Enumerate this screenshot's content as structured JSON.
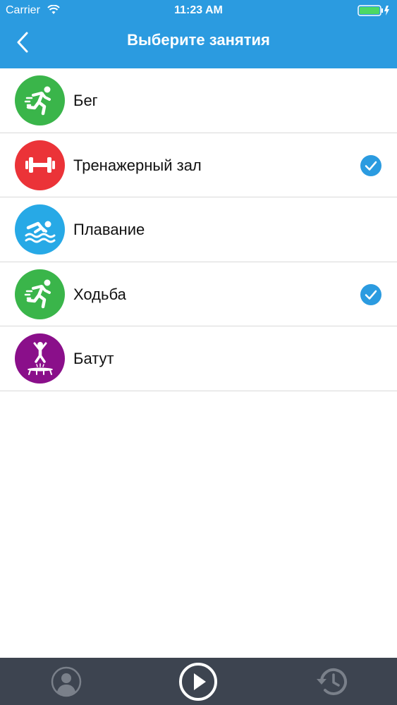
{
  "status_bar": {
    "carrier": "Carrier",
    "time": "11:23 AM"
  },
  "nav": {
    "title": "Выберите занятия"
  },
  "colors": {
    "header": "#2b9be0",
    "check": "#2b9be0",
    "tab_bar": "#3d4450"
  },
  "activities": [
    {
      "label": "Бег",
      "icon": "running-icon",
      "color": "#3ab54a",
      "checked": false
    },
    {
      "label": "Тренажерный зал",
      "icon": "dumbbell-icon",
      "color": "#eb3338",
      "checked": true
    },
    {
      "label": "Плавание",
      "icon": "swimming-icon",
      "color": "#27a9e6",
      "checked": false
    },
    {
      "label": "Ходьба",
      "icon": "walking-icon",
      "color": "#3ab54a",
      "checked": true
    },
    {
      "label": "Батут",
      "icon": "trampoline-icon",
      "color": "#8a0f8a",
      "checked": false
    }
  ],
  "tabs": [
    {
      "icon": "profile-icon"
    },
    {
      "icon": "play-icon"
    },
    {
      "icon": "history-icon"
    }
  ]
}
